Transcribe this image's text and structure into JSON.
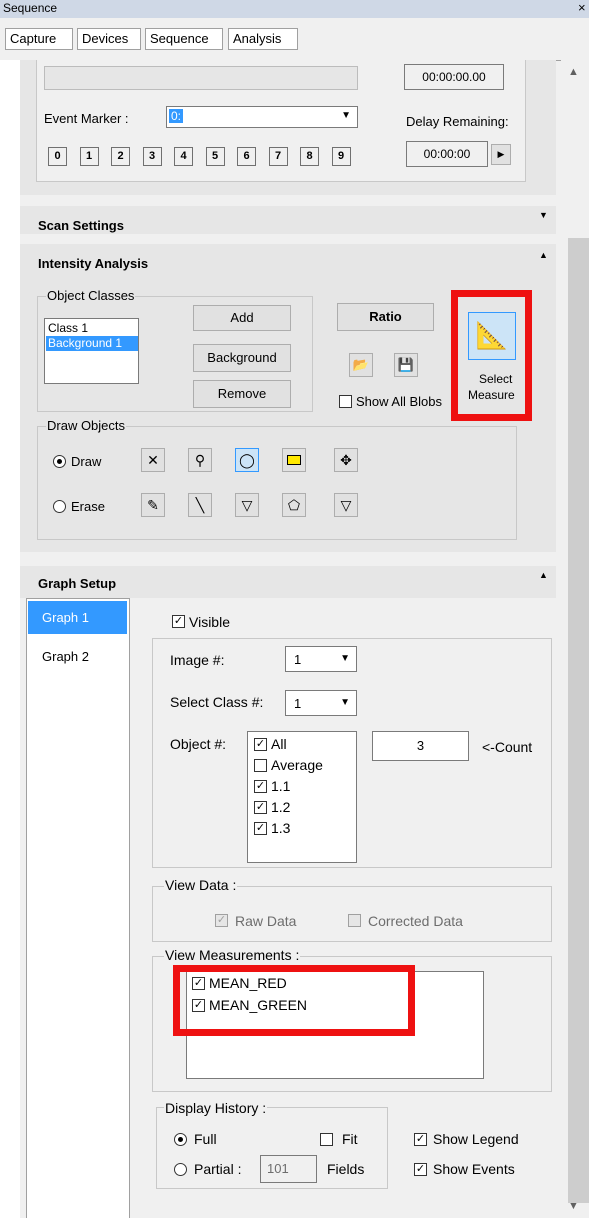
{
  "window": {
    "title": "Sequence",
    "close": "×"
  },
  "tabs": [
    "Capture",
    "Devices",
    "Sequence",
    "Analysis"
  ],
  "capture": {
    "time_value": "00:00:00.00",
    "event_marker_label": "Event Marker :",
    "event_marker_value": "0:",
    "delay_label": "Delay Remaining:",
    "delay_value": "00:00:00",
    "markers": [
      "0",
      "1",
      "2",
      "3",
      "4",
      "5",
      "6",
      "7",
      "8",
      "9"
    ]
  },
  "scan_settings": {
    "title": "Scan Settings"
  },
  "intensity": {
    "title": "Intensity Analysis",
    "object_classes_label": "Object Classes",
    "classes": [
      "Class 1",
      "Background 1"
    ],
    "selected_class_index": 1,
    "add": "Add",
    "background": "Background",
    "remove": "Remove",
    "ratio": "Ratio",
    "show_all_blobs": "Show All Blobs",
    "select_measure_line1": "Select",
    "select_measure_line2": "Measure",
    "draw_objects_label": "Draw Objects",
    "draw": "Draw",
    "erase": "Erase",
    "draw_checked": true
  },
  "graph_setup": {
    "title": "Graph Setup",
    "graphs": [
      "Graph 1",
      "Graph 2"
    ],
    "active_graph": 0,
    "visible": "Visible",
    "image_label": "Image #:",
    "image_value": "1",
    "select_class_label": "Select Class #:",
    "select_class_value": "1",
    "object_label": "Object #:",
    "objects": [
      {
        "label": "All",
        "checked": true
      },
      {
        "label": "Average",
        "checked": false
      },
      {
        "label": "1.1",
        "checked": true
      },
      {
        "label": "1.2",
        "checked": true
      },
      {
        "label": "1.3",
        "checked": true
      }
    ],
    "count_value": "3",
    "count_label": "<-Count",
    "view_data_label": "View Data :",
    "raw_data": "Raw Data",
    "corrected_data": "Corrected Data",
    "view_measurements_label": "View Measurements :",
    "measurements": [
      {
        "label": "MEAN_RED",
        "checked": true
      },
      {
        "label": "MEAN_GREEN",
        "checked": true
      }
    ],
    "display_history_label": "Display History :",
    "full": "Full",
    "partial": "Partial :",
    "partial_value": "101",
    "fields": "Fields",
    "fit": "Fit",
    "show_legend": "Show Legend",
    "show_events": "Show Events"
  },
  "colors": {
    "highlight": "#ee1111",
    "selection": "#3399ff",
    "active_tab": "#3399ff"
  }
}
